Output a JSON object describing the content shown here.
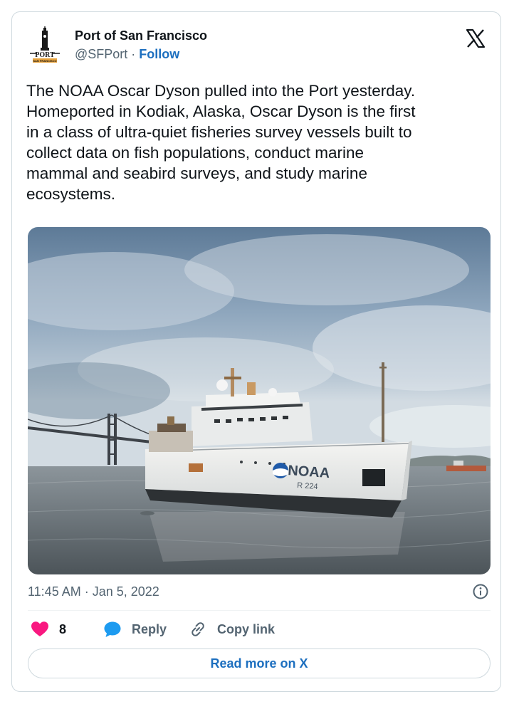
{
  "author": {
    "display_name": "Port of San Francisco",
    "handle": "@SFPort",
    "separator": " · ",
    "follow_label": "Follow",
    "avatar_text": "PORT",
    "avatar_subtext": "SAN FRANCISCO"
  },
  "tweet": {
    "text": "The NOAA Oscar Dyson pulled into the Port yesterday.\nHomeported in Kodiak, Alaska, Oscar Dyson is the first\nin a class of ultra-quiet fisheries survey vessels built to\ncollect data on fish populations, conduct marine\nmammal and seabird surveys, and study marine\necosystems.",
    "timestamp": "11:45 AM · Jan 5, 2022"
  },
  "media": {
    "hull_name": "NOAA",
    "hull_number": "R 224"
  },
  "actions": {
    "like_count": "8",
    "reply_label": "Reply",
    "copy_link_label": "Copy link"
  },
  "read_more_label": "Read more on X",
  "colors": {
    "like_heart": "#f91880",
    "reply_bubble": "#1d9bf0",
    "link_blue": "#1d6fbf",
    "secondary_text": "#536471",
    "border": "#cfd9de"
  }
}
